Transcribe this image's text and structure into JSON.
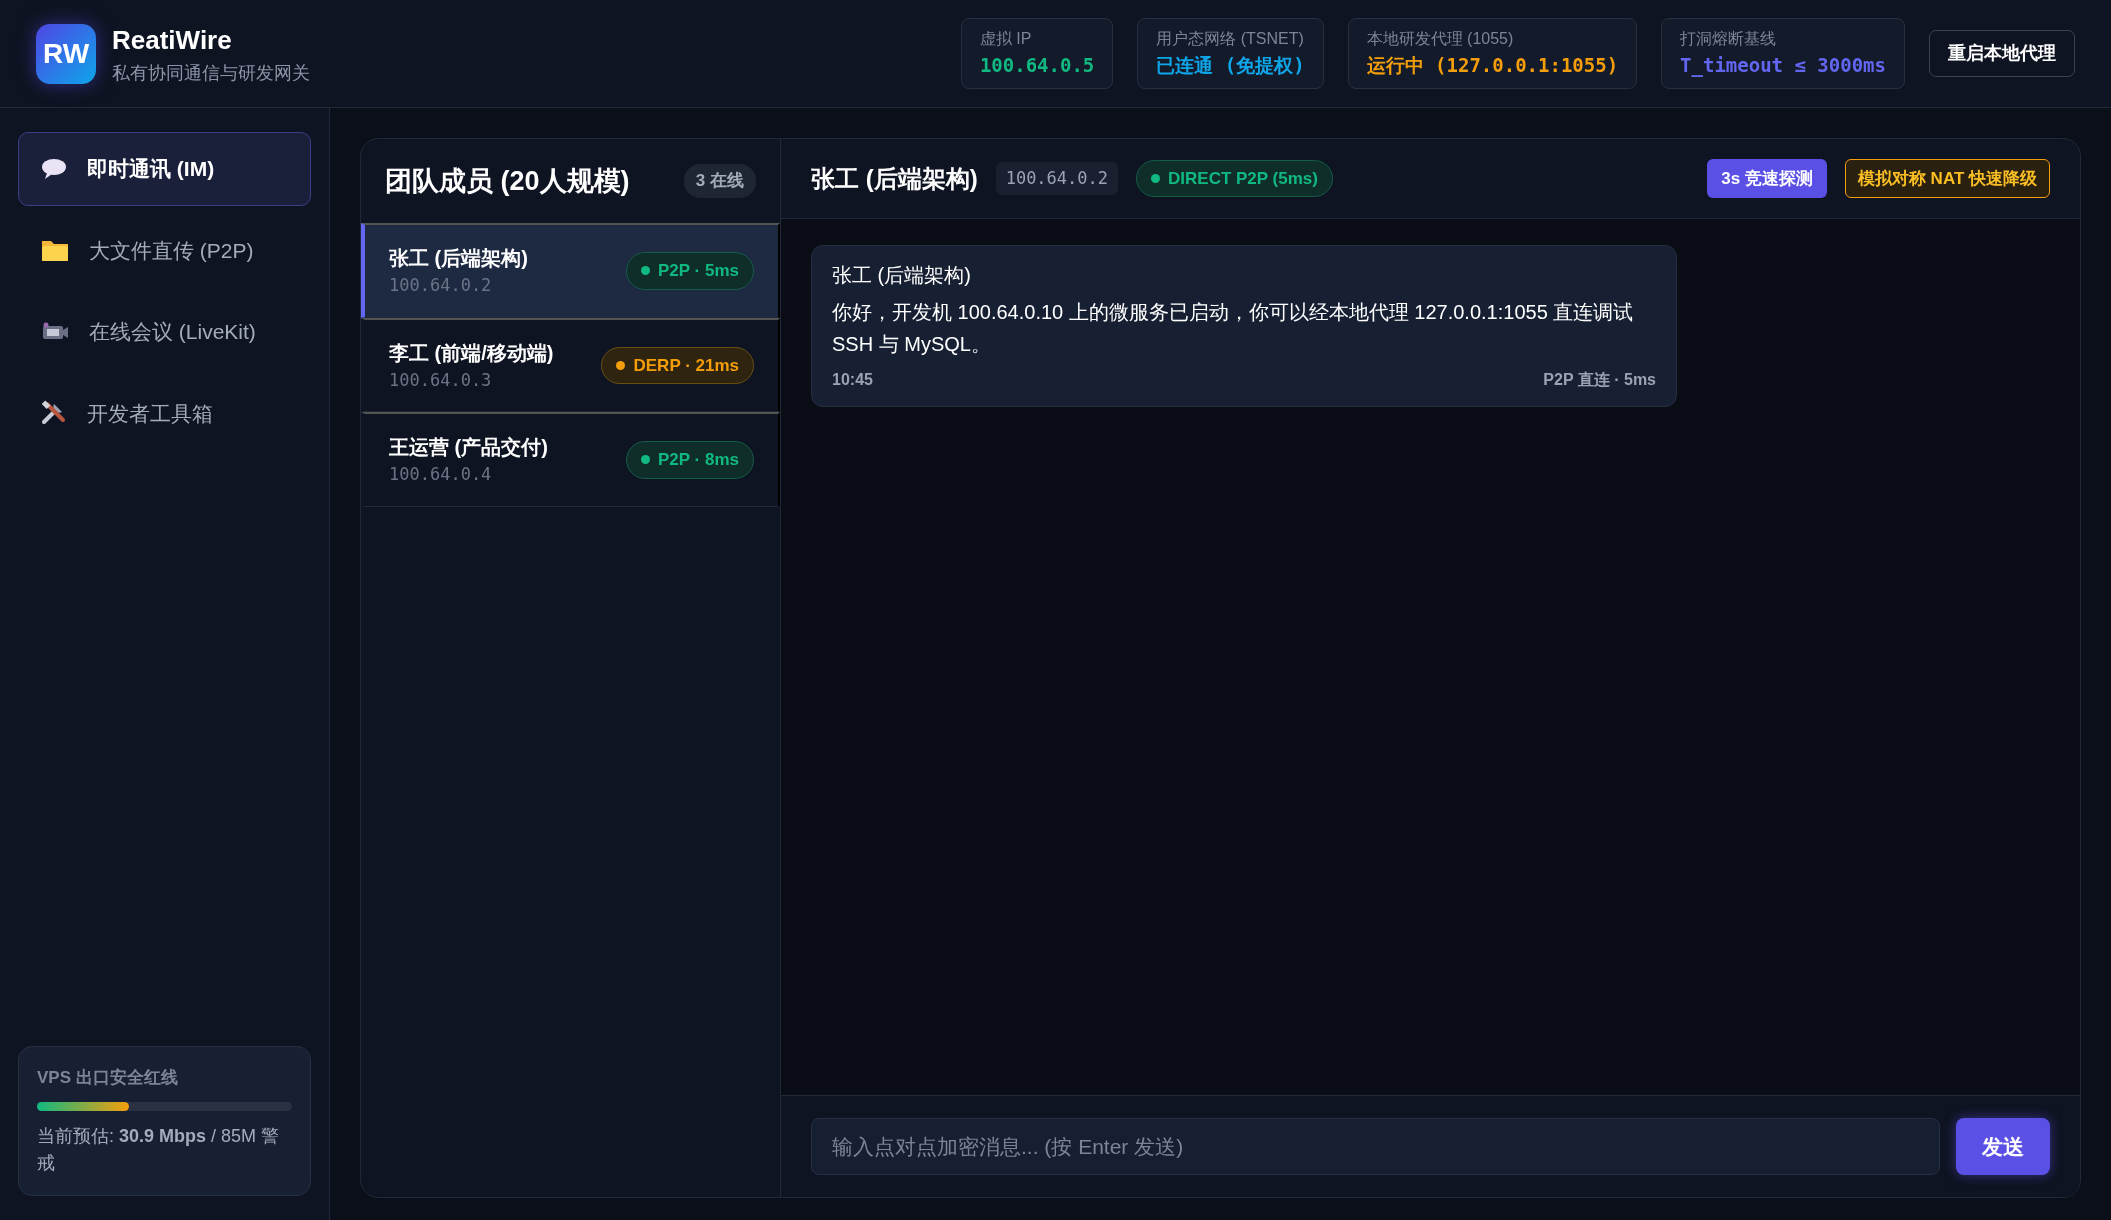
{
  "app": {
    "logo": "RW",
    "title": "ReatiWire",
    "subtitle": "私有协同通信与研发网关"
  },
  "stats": [
    {
      "label": "虚拟 IP",
      "value": "100.64.0.5",
      "color": "#10b981"
    },
    {
      "label": "用户态网络 (TSNET)",
      "value": "已连通 (免提权)",
      "color": "#0ea5e9"
    },
    {
      "label": "本地研发代理 (1055)",
      "value": "运行中 (127.0.0.1:1055)",
      "color": "#f59e0b"
    },
    {
      "label": "打洞熔断基线",
      "value": "T_timeout ≤ 3000ms",
      "color": "#6366f1"
    }
  ],
  "header_button": "重启本地代理",
  "nav": [
    {
      "label": "即时通讯 (IM)",
      "kind": "chat",
      "selected": true
    },
    {
      "label": "大文件直传 (P2P)",
      "kind": "folder",
      "selected": false
    },
    {
      "label": "在线会议 (LiveKit)",
      "kind": "camera",
      "selected": false
    },
    {
      "label": "开发者工具箱",
      "kind": "tools",
      "selected": false
    }
  ],
  "egress": {
    "title": "VPS 出口安全红线",
    "level": 0.36,
    "text": "当前预估: **30.9 Mbps** / 85M 警戒"
  },
  "members_panel": {
    "title": "团队成员 (20人规模)",
    "online": "3 在线"
  },
  "members": [
    {
      "name": "张工 (后端架构)",
      "ip": "100.64.0.2",
      "badge": "P2P · 5ms",
      "kind": "p2p",
      "selected": true
    },
    {
      "name": "李工 (前端/移动端)",
      "ip": "100.64.0.3",
      "badge": "DERP · 21ms",
      "kind": "derp",
      "selected": false
    },
    {
      "name": "王运营 (产品交付)",
      "ip": "100.64.0.4",
      "badge": "P2P · 8ms",
      "kind": "p2p",
      "selected": false
    }
  ],
  "chat": {
    "peer": "张工 (后端架构)",
    "ip": "100.64.0.2",
    "link": "DIRECT P2P (5ms)",
    "probe_button": "3s 竞速探测",
    "nat_button": "模拟对称 NAT 快速降级",
    "messages": [
      {
        "sender": "张工 (后端架构)",
        "text": "你好，开发机 100.64.0.10 上的微服务已启动，你可以经本地代理 127.0.0.1:1055 直连调试 SSH 与 MySQL。",
        "time": "10:45",
        "route": "P2P 直连 · 5ms"
      }
    ],
    "input_placeholder": "输入点对点加密消息... (按 Enter 发送)",
    "send_button": "发送"
  }
}
